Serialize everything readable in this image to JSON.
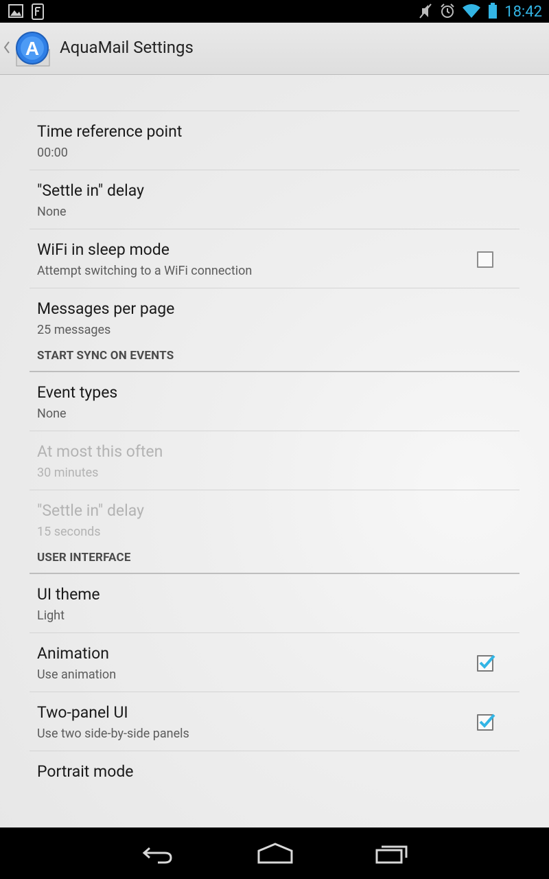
{
  "status_bar": {
    "time": "18:42",
    "left_icons": [
      "gallery-icon",
      "flipboard-icon"
    ],
    "right_icons": [
      "mute-icon",
      "alarm-icon",
      "wifi-icon",
      "battery-icon"
    ],
    "accent_color": "#33b5e5"
  },
  "action_bar": {
    "title": "AquaMail Settings",
    "logo_letter": "A"
  },
  "preferences_top": [
    {
      "title": "Time reference point",
      "summary": "00:00"
    },
    {
      "title": "\"Settle in\" delay",
      "summary": "None"
    },
    {
      "title": "WiFi in sleep mode",
      "summary": "Attempt switching to a WiFi connection",
      "checkbox": true,
      "checked": false
    },
    {
      "title": "Messages per page",
      "summary": "25 messages"
    }
  ],
  "sync_section": {
    "header": "START SYNC ON EVENTS",
    "items": [
      {
        "title": "Event types",
        "summary": "None",
        "enabled": true
      },
      {
        "title": "At most this often",
        "summary": "30 minutes",
        "enabled": false
      },
      {
        "title": "\"Settle in\" delay",
        "summary": "15 seconds",
        "enabled": false
      }
    ]
  },
  "ui_section": {
    "header": "USER INTERFACE",
    "items": [
      {
        "title": "UI theme",
        "summary": "Light"
      },
      {
        "title": "Animation",
        "summary": "Use animation",
        "checkbox": true,
        "checked": true
      },
      {
        "title": "Two-panel UI",
        "summary": "Use two side-by-side panels",
        "checkbox": true,
        "checked": true
      },
      {
        "title": "Portrait mode",
        "summary": ""
      }
    ]
  },
  "nav_bar": {
    "buttons": [
      "back-icon",
      "home-icon",
      "recent-apps-icon"
    ]
  }
}
